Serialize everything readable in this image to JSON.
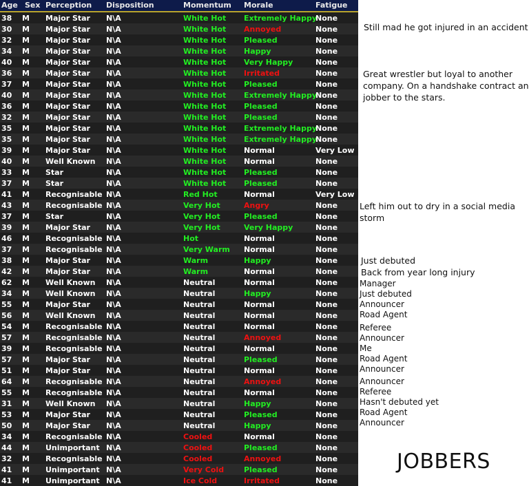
{
  "header": {
    "age": "Age",
    "sex": "Sex",
    "perception": "Perception",
    "disposition": "Disposition",
    "momentum": "Momentum",
    "morale": "Morale",
    "fatigue": "Fatigue"
  },
  "colors": {
    "header_bg": "#0e1b4a",
    "header_rule": "#b8a42c",
    "white": "#ffffff",
    "green": "#22ee22",
    "red": "#ee1111"
  },
  "rows": [
    {
      "age": "38",
      "sex": "M",
      "perception": "Major Star",
      "disposition": "N\\A",
      "momentum": "White Hot",
      "momentum_color": "green",
      "morale": "Extremely Happy",
      "morale_color": "green",
      "fatigue": "None"
    },
    {
      "age": "30",
      "sex": "M",
      "perception": "Major Star",
      "disposition": "N\\A",
      "momentum": "White Hot",
      "momentum_color": "green",
      "morale": "Annoyed",
      "morale_color": "red",
      "fatigue": "None"
    },
    {
      "age": "32",
      "sex": "M",
      "perception": "Major Star",
      "disposition": "N\\A",
      "momentum": "White Hot",
      "momentum_color": "green",
      "morale": "Pleased",
      "morale_color": "green",
      "fatigue": "None"
    },
    {
      "age": "34",
      "sex": "M",
      "perception": "Major Star",
      "disposition": "N\\A",
      "momentum": "White Hot",
      "momentum_color": "green",
      "morale": "Happy",
      "morale_color": "green",
      "fatigue": "None"
    },
    {
      "age": "40",
      "sex": "M",
      "perception": "Major Star",
      "disposition": "N\\A",
      "momentum": "White Hot",
      "momentum_color": "green",
      "morale": "Very Happy",
      "morale_color": "green",
      "fatigue": "None"
    },
    {
      "age": "36",
      "sex": "M",
      "perception": "Major Star",
      "disposition": "N\\A",
      "momentum": "White Hot",
      "momentum_color": "green",
      "morale": "Irritated",
      "morale_color": "red",
      "fatigue": "None"
    },
    {
      "age": "37",
      "sex": "M",
      "perception": "Major Star",
      "disposition": "N\\A",
      "momentum": "White Hot",
      "momentum_color": "green",
      "morale": "Pleased",
      "morale_color": "green",
      "fatigue": "None"
    },
    {
      "age": "40",
      "sex": "M",
      "perception": "Major Star",
      "disposition": "N\\A",
      "momentum": "White Hot",
      "momentum_color": "green",
      "morale": "Extremely Happy",
      "morale_color": "green",
      "fatigue": "None"
    },
    {
      "age": "36",
      "sex": "M",
      "perception": "Major Star",
      "disposition": "N\\A",
      "momentum": "White Hot",
      "momentum_color": "green",
      "morale": "Pleased",
      "morale_color": "green",
      "fatigue": "None"
    },
    {
      "age": "32",
      "sex": "M",
      "perception": "Major Star",
      "disposition": "N\\A",
      "momentum": "White Hot",
      "momentum_color": "green",
      "morale": "Pleased",
      "morale_color": "green",
      "fatigue": "None"
    },
    {
      "age": "35",
      "sex": "M",
      "perception": "Major Star",
      "disposition": "N\\A",
      "momentum": "White Hot",
      "momentum_color": "green",
      "morale": "Extremely Happy",
      "morale_color": "green",
      "fatigue": "None"
    },
    {
      "age": "35",
      "sex": "M",
      "perception": "Major Star",
      "disposition": "N\\A",
      "momentum": "White Hot",
      "momentum_color": "green",
      "morale": "Extremely Happy",
      "morale_color": "green",
      "fatigue": "None"
    },
    {
      "age": "39",
      "sex": "M",
      "perception": "Major Star",
      "disposition": "N\\A",
      "momentum": "White Hot",
      "momentum_color": "green",
      "morale": "Normal",
      "morale_color": "white",
      "fatigue": "Very Low"
    },
    {
      "age": "40",
      "sex": "M",
      "perception": "Well Known",
      "disposition": "N\\A",
      "momentum": "White Hot",
      "momentum_color": "green",
      "morale": "Normal",
      "morale_color": "white",
      "fatigue": "None"
    },
    {
      "age": "33",
      "sex": "M",
      "perception": "Star",
      "disposition": "N\\A",
      "momentum": "White Hot",
      "momentum_color": "green",
      "morale": "Pleased",
      "morale_color": "green",
      "fatigue": "None"
    },
    {
      "age": "37",
      "sex": "M",
      "perception": "Star",
      "disposition": "N\\A",
      "momentum": "White Hot",
      "momentum_color": "green",
      "morale": "Pleased",
      "morale_color": "green",
      "fatigue": "None"
    },
    {
      "age": "41",
      "sex": "M",
      "perception": "Recognisable",
      "disposition": "N\\A",
      "momentum": "Red Hot",
      "momentum_color": "green",
      "morale": "Normal",
      "morale_color": "white",
      "fatigue": "Very Low"
    },
    {
      "age": "43",
      "sex": "M",
      "perception": "Recognisable",
      "disposition": "N\\A",
      "momentum": "Very Hot",
      "momentum_color": "green",
      "morale": "Angry",
      "morale_color": "red",
      "fatigue": "None"
    },
    {
      "age": "37",
      "sex": "M",
      "perception": "Star",
      "disposition": "N\\A",
      "momentum": "Very Hot",
      "momentum_color": "green",
      "morale": "Pleased",
      "morale_color": "green",
      "fatigue": "None"
    },
    {
      "age": "39",
      "sex": "M",
      "perception": "Major Star",
      "disposition": "N\\A",
      "momentum": "Very Hot",
      "momentum_color": "green",
      "morale": "Very Happy",
      "morale_color": "green",
      "fatigue": "None"
    },
    {
      "age": "46",
      "sex": "M",
      "perception": "Recognisable",
      "disposition": "N\\A",
      "momentum": "Hot",
      "momentum_color": "green",
      "morale": "Normal",
      "morale_color": "white",
      "fatigue": "None"
    },
    {
      "age": "37",
      "sex": "M",
      "perception": "Recognisable",
      "disposition": "N\\A",
      "momentum": "Very Warm",
      "momentum_color": "green",
      "morale": "Normal",
      "morale_color": "white",
      "fatigue": "None"
    },
    {
      "age": "38",
      "sex": "M",
      "perception": "Major Star",
      "disposition": "N\\A",
      "momentum": "Warm",
      "momentum_color": "green",
      "morale": "Happy",
      "morale_color": "green",
      "fatigue": "None"
    },
    {
      "age": "42",
      "sex": "M",
      "perception": "Major Star",
      "disposition": "N\\A",
      "momentum": "Warm",
      "momentum_color": "green",
      "morale": "Normal",
      "morale_color": "white",
      "fatigue": "None"
    },
    {
      "age": "62",
      "sex": "M",
      "perception": "Well Known",
      "disposition": "N\\A",
      "momentum": "Neutral",
      "momentum_color": "white",
      "morale": "Normal",
      "morale_color": "white",
      "fatigue": "None"
    },
    {
      "age": "34",
      "sex": "M",
      "perception": "Well Known",
      "disposition": "N\\A",
      "momentum": "Neutral",
      "momentum_color": "white",
      "morale": "Happy",
      "morale_color": "green",
      "fatigue": "None"
    },
    {
      "age": "55",
      "sex": "M",
      "perception": "Major Star",
      "disposition": "N\\A",
      "momentum": "Neutral",
      "momentum_color": "white",
      "morale": "Normal",
      "morale_color": "white",
      "fatigue": "None"
    },
    {
      "age": "56",
      "sex": "M",
      "perception": "Well Known",
      "disposition": "N\\A",
      "momentum": "Neutral",
      "momentum_color": "white",
      "morale": "Normal",
      "morale_color": "white",
      "fatigue": "None"
    },
    {
      "age": "54",
      "sex": "M",
      "perception": "Recognisable",
      "disposition": "N\\A",
      "momentum": "Neutral",
      "momentum_color": "white",
      "morale": "Normal",
      "morale_color": "white",
      "fatigue": "None"
    },
    {
      "age": "57",
      "sex": "M",
      "perception": "Recognisable",
      "disposition": "N\\A",
      "momentum": "Neutral",
      "momentum_color": "white",
      "morale": "Annoyed",
      "morale_color": "red",
      "fatigue": "None"
    },
    {
      "age": "39",
      "sex": "M",
      "perception": "Recognisable",
      "disposition": "N\\A",
      "momentum": "Neutral",
      "momentum_color": "white",
      "morale": "Normal",
      "morale_color": "white",
      "fatigue": "None"
    },
    {
      "age": "57",
      "sex": "M",
      "perception": "Major Star",
      "disposition": "N\\A",
      "momentum": "Neutral",
      "momentum_color": "white",
      "morale": "Pleased",
      "morale_color": "green",
      "fatigue": "None"
    },
    {
      "age": "51",
      "sex": "M",
      "perception": "Major Star",
      "disposition": "N\\A",
      "momentum": "Neutral",
      "momentum_color": "white",
      "morale": "Normal",
      "morale_color": "white",
      "fatigue": "None"
    },
    {
      "age": "64",
      "sex": "M",
      "perception": "Recognisable",
      "disposition": "N\\A",
      "momentum": "Neutral",
      "momentum_color": "white",
      "morale": "Annoyed",
      "morale_color": "red",
      "fatigue": "None"
    },
    {
      "age": "55",
      "sex": "M",
      "perception": "Recognisable",
      "disposition": "N\\A",
      "momentum": "Neutral",
      "momentum_color": "white",
      "morale": "Normal",
      "morale_color": "white",
      "fatigue": "None"
    },
    {
      "age": "31",
      "sex": "M",
      "perception": "Well Known",
      "disposition": "N\\A",
      "momentum": "Neutral",
      "momentum_color": "white",
      "morale": "Happy",
      "morale_color": "green",
      "fatigue": "None"
    },
    {
      "age": "53",
      "sex": "M",
      "perception": "Major Star",
      "disposition": "N\\A",
      "momentum": "Neutral",
      "momentum_color": "white",
      "morale": "Pleased",
      "morale_color": "green",
      "fatigue": "None"
    },
    {
      "age": "50",
      "sex": "M",
      "perception": "Major Star",
      "disposition": "N\\A",
      "momentum": "Neutral",
      "momentum_color": "white",
      "morale": "Happy",
      "morale_color": "green",
      "fatigue": "None"
    },
    {
      "age": "34",
      "sex": "M",
      "perception": "Recognisable",
      "disposition": "N\\A",
      "momentum": "Cooled",
      "momentum_color": "red",
      "morale": "Normal",
      "morale_color": "white",
      "fatigue": "None"
    },
    {
      "age": "44",
      "sex": "M",
      "perception": "Unimportant",
      "disposition": "N\\A",
      "momentum": "Cooled",
      "momentum_color": "red",
      "morale": "Pleased",
      "morale_color": "green",
      "fatigue": "None"
    },
    {
      "age": "32",
      "sex": "M",
      "perception": "Recognisable",
      "disposition": "N\\A",
      "momentum": "Cooled",
      "momentum_color": "red",
      "morale": "Annoyed",
      "morale_color": "red",
      "fatigue": "None"
    },
    {
      "age": "41",
      "sex": "M",
      "perception": "Unimportant",
      "disposition": "N\\A",
      "momentum": "Very Cold",
      "momentum_color": "red",
      "morale": "Pleased",
      "morale_color": "green",
      "fatigue": "None"
    },
    {
      "age": "41",
      "sex": "M",
      "perception": "Unimportant",
      "disposition": "N\\A",
      "momentum": "Ice Cold",
      "momentum_color": "red",
      "morale": "Irritated",
      "morale_color": "red",
      "fatigue": "None"
    }
  ],
  "notes": [
    {
      "text": "Still mad he got injured in an accident",
      "size": "large"
    },
    {
      "text": "Great wrestler but loyal to another",
      "size": "large"
    },
    {
      "text": "company. On a handshake contract and",
      "size": "large"
    },
    {
      "text": "jobber to the stars.",
      "size": "large"
    },
    {
      "text": "Left him out to dry in a social media",
      "size": "large"
    },
    {
      "text": "storm",
      "size": "large"
    },
    {
      "text": "Just debuted",
      "size": "large"
    },
    {
      "text": "Back from year long injury",
      "size": "large"
    },
    {
      "text": "Manager",
      "size": "small"
    },
    {
      "text": "Just debuted",
      "size": "small"
    },
    {
      "text": "Announcer",
      "size": "small"
    },
    {
      "text": "Road Agent",
      "size": "small"
    },
    {
      "text": "Referee",
      "size": "small"
    },
    {
      "text": "Announcer",
      "size": "small"
    },
    {
      "text": "Me",
      "size": "small"
    },
    {
      "text": "Road Agent",
      "size": "small"
    },
    {
      "text": "Announcer",
      "size": "small"
    },
    {
      "text": "Announcer",
      "size": "small"
    },
    {
      "text": "Referee",
      "size": "small"
    },
    {
      "text": "Hasn't debuted yet",
      "size": "small"
    },
    {
      "text": "Road Agent",
      "size": "small"
    },
    {
      "text": "Announcer",
      "size": "small"
    }
  ],
  "footer_label": "JOBBERS"
}
